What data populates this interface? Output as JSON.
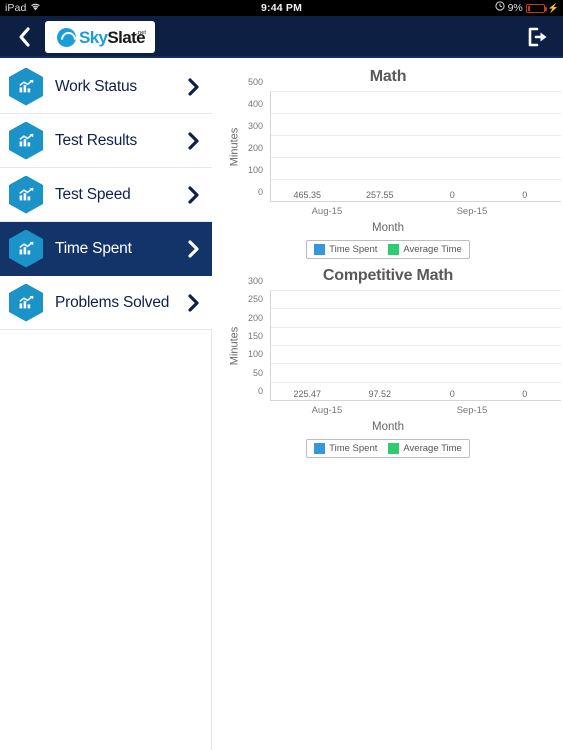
{
  "status_bar": {
    "device": "iPad",
    "wifi_icon": "wifi-icon",
    "time": "9:44 PM",
    "alarm_icon": "alarm-clock-icon",
    "battery_percent": "9%",
    "battery_icon": "battery-low-icon",
    "charging_icon": "lightning-bolt-icon"
  },
  "navbar": {
    "back_icon": "chevron-left-icon",
    "logout_icon": "logout-icon",
    "logo": {
      "mark": "skyslate-swirl-icon",
      "text_primary": "Sky",
      "text_secondary": "Slate",
      "text_suffix": ".net"
    },
    "colors": {
      "background": "#0e1f44",
      "accent": "#1b9dd9"
    }
  },
  "sidebar": {
    "items": [
      {
        "label": "Work Status",
        "icon": "bar-chart-hexagon-icon",
        "chevron": "chevron-right-icon",
        "selected": false
      },
      {
        "label": "Test Results",
        "icon": "bar-chart-hexagon-icon",
        "chevron": "chevron-right-icon",
        "selected": false
      },
      {
        "label": "Test Speed",
        "icon": "bar-chart-hexagon-icon",
        "chevron": "chevron-right-icon",
        "selected": false
      },
      {
        "label": "Time Spent",
        "icon": "bar-chart-hexagon-icon",
        "chevron": "chevron-right-icon",
        "selected": true
      },
      {
        "label": "Problems Solved",
        "icon": "bar-chart-hexagon-icon",
        "chevron": "chevron-right-icon",
        "selected": false
      }
    ],
    "colors": {
      "selected_background": "#123468",
      "icon": "#1b93c8",
      "label": "#11204a"
    }
  },
  "chart_data": [
    {
      "type": "bar",
      "title": "Math",
      "xlabel": "Month",
      "ylabel": "Minutes",
      "categories": [
        "Aug-15",
        "Sep-15"
      ],
      "yticks": [
        0,
        100,
        200,
        300,
        400,
        500
      ],
      "ylim": [
        0,
        500
      ],
      "grid": true,
      "legend_position": "bottom",
      "series": [
        {
          "name": "Time Spent",
          "color": "#3498db",
          "values": [
            465.35,
            0
          ],
          "labels": [
            "465.35",
            "0"
          ]
        },
        {
          "name": "Average Time",
          "color": "#2ecc71",
          "values": [
            257.55,
            0
          ],
          "labels": [
            "257.55",
            "0"
          ]
        }
      ]
    },
    {
      "type": "bar",
      "title": "Competitive Math",
      "xlabel": "Month",
      "ylabel": "Minutes",
      "categories": [
        "Aug-15",
        "Sep-15"
      ],
      "yticks": [
        0,
        50,
        100,
        150,
        200,
        250,
        300
      ],
      "ylim": [
        0,
        300
      ],
      "grid": true,
      "legend_position": "bottom",
      "series": [
        {
          "name": "Time Spent",
          "color": "#3498db",
          "values": [
            225.47,
            0
          ],
          "labels": [
            "225.47",
            "0"
          ]
        },
        {
          "name": "Average Time",
          "color": "#2ecc71",
          "values": [
            97.52,
            0
          ],
          "labels": [
            "97.52",
            "0"
          ]
        }
      ]
    }
  ]
}
